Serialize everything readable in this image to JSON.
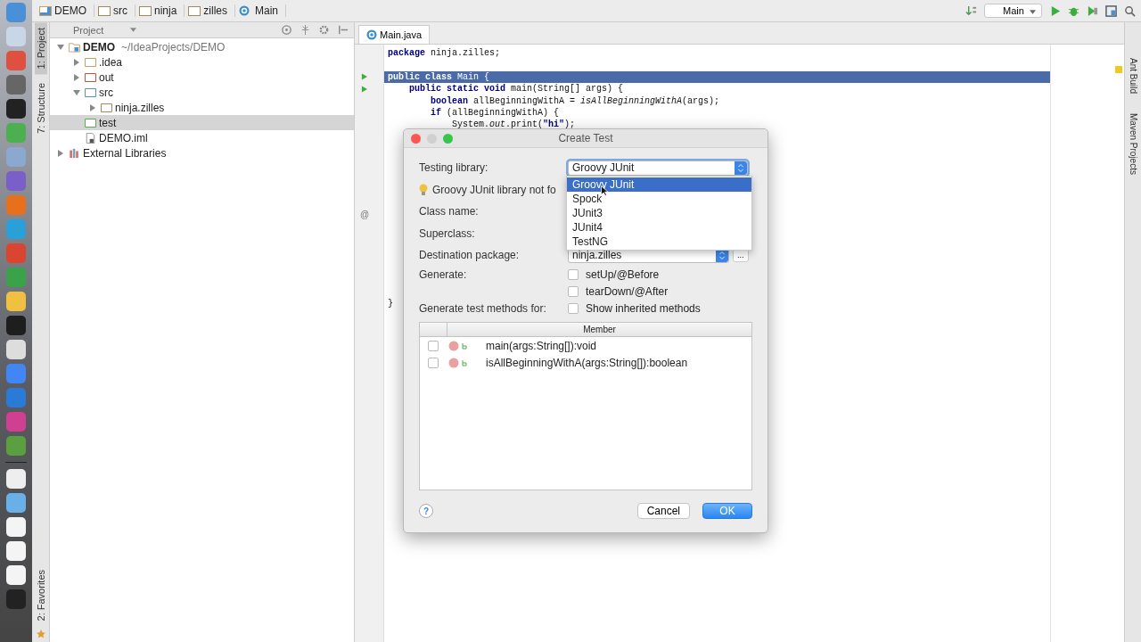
{
  "breadcrumbs": [
    {
      "label": "DEMO",
      "kind": "module"
    },
    {
      "label": "src",
      "kind": "folder"
    },
    {
      "label": "ninja",
      "kind": "folder"
    },
    {
      "label": "zilles",
      "kind": "folder"
    },
    {
      "label": "Main",
      "kind": "class"
    }
  ],
  "toolbar": {
    "run_config": "Main"
  },
  "left_tool_tabs": [
    {
      "label": "1: Project",
      "selected": true
    },
    {
      "label": "7: Structure",
      "selected": false
    }
  ],
  "bottom_tool_tabs": [
    {
      "label": "2: Favorites",
      "selected": false
    }
  ],
  "right_tool_tabs": [
    {
      "label": "Ant Build"
    },
    {
      "label": "Maven Projects"
    }
  ],
  "project_panel": {
    "title": "Project",
    "tree": [
      {
        "label": "DEMO",
        "hint": "~/IdeaProjects/DEMO",
        "kind": "module",
        "expanded": true,
        "selected": false,
        "children": [
          {
            "label": ".idea",
            "kind": "folder",
            "color": "#c8a060",
            "expanded": false,
            "selected": false
          },
          {
            "label": "out",
            "kind": "folder",
            "color": "#c8503c",
            "expanded": false,
            "selected": false
          },
          {
            "label": "src",
            "kind": "folder",
            "color": "#5a8fc8",
            "expanded": true,
            "selected": false,
            "children": [
              {
                "label": "ninja.zilles",
                "kind": "package",
                "color": "#a08860",
                "expanded": false,
                "selected": false
              }
            ]
          },
          {
            "label": "test",
            "kind": "folder",
            "color": "#5caa5c",
            "selected": true
          },
          {
            "label": "DEMO.iml",
            "kind": "file",
            "selected": false
          }
        ]
      },
      {
        "label": "External Libraries",
        "kind": "library",
        "expanded": false,
        "selected": false
      }
    ]
  },
  "editor": {
    "tabs": [
      {
        "label": "Main.java",
        "selected": true
      }
    ],
    "lines": [
      {
        "text": "**package** ninja.zilles;",
        "highlighted": false,
        "run_marker": false
      },
      {
        "text": "**public class** Main {",
        "highlighted": true,
        "run_marker": true
      },
      {
        "text": "    **public static void** main(String[] args) {",
        "highlighted": false,
        "run_marker": true
      },
      {
        "text": "        **boolean** allBeginningWithA = *isAllBeginningWithA*(args);",
        "highlighted": false,
        "run_marker": false
      },
      {
        "text": "        **if** (allBeginningWithA) {",
        "highlighted": false,
        "run_marker": false
      },
      {
        "text": "            System.*out*.print(**\"hi\"**);",
        "highlighted": false,
        "run_marker": false
      }
    ],
    "closing_brace": "}",
    "gutter_mark": "@"
  },
  "dialog": {
    "title": "Create Test",
    "testing_library": {
      "label": "Testing library:",
      "value": "Groovy JUnit",
      "expanded": true,
      "options": [
        {
          "label": "Groovy JUnit",
          "selected": true
        },
        {
          "label": "Spock",
          "selected": false
        },
        {
          "label": "JUnit3",
          "selected": false
        },
        {
          "label": "JUnit4",
          "selected": false
        },
        {
          "label": "TestNG",
          "selected": false
        }
      ]
    },
    "hint": "Groovy JUnit library not fo",
    "class_name_label": "Class name:",
    "superclass_label": "Superclass:",
    "destination": {
      "label": "Destination package:",
      "value": "ninja.zilles",
      "browse": "..."
    },
    "generate_label": "Generate:",
    "generate_options": [
      {
        "label": "setUp/@Before",
        "checked": false
      },
      {
        "label": "tearDown/@After",
        "checked": false
      }
    ],
    "methods_label": "Generate test methods for:",
    "show_inherited": {
      "label": "Show inherited methods",
      "checked": false
    },
    "table": {
      "columns": [
        "Member"
      ],
      "rows": [
        {
          "member": "main(args:String[]):void",
          "checked": false
        },
        {
          "member": "isAllBeginningWithA(args:String[]):boolean",
          "checked": false
        }
      ]
    },
    "help": "?",
    "buttons": [
      {
        "label": "Cancel",
        "kind": "secondary"
      },
      {
        "label": "OK",
        "kind": "primary"
      }
    ]
  }
}
